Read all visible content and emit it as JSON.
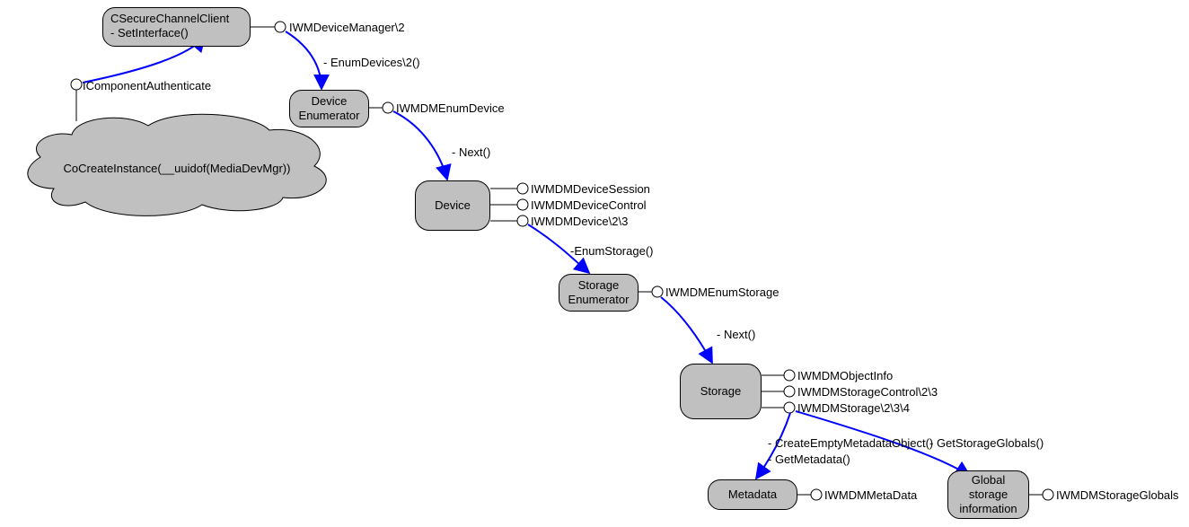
{
  "nodes": {
    "secure_channel": {
      "line1": "CSecureChannelClient",
      "line2": "- SetInterface()"
    },
    "cocreate": "CoCreateInstance(__uuidof(MediaDevMgr))",
    "device_enum": {
      "line1": "Device",
      "line2": "Enumerator"
    },
    "device": "Device",
    "storage_enum": {
      "line1": "Storage",
      "line2": "Enumerator"
    },
    "storage": "Storage",
    "metadata": "Metadata",
    "global_storage": {
      "line1": "Global",
      "line2": "storage",
      "line3": "information"
    }
  },
  "interfaces": {
    "icomponent_auth": "IComponentAuthenticate",
    "iwmdevicemanager": "IWMDeviceManager\\2",
    "iwmdm_enumdevice": "IWMDMEnumDevice",
    "iwmdm_devicesession": "IWMDMDeviceSession",
    "iwmdm_devicecontrol": "IWMDMDeviceControl",
    "iwmdm_device": "IWMDMDevice\\2\\3",
    "iwmdm_enumstorage": "IWMDMEnumStorage",
    "iwmdm_objectinfo": "IWMDMObjectInfo",
    "iwmdm_storagecontrol": "IWMDMStorageControl\\2\\3",
    "iwmdm_storage": "IWMDMStorage\\2\\3\\4",
    "iwmdm_metadata": "IWMDMMetaData",
    "iwmdm_storageglobals": "IWMDMStorageGlobals"
  },
  "methods": {
    "enum_devices": "- EnumDevices\\2()",
    "next1": "- Next()",
    "enum_storage": "-EnumStorage()",
    "next2": "- Next()",
    "create_empty_meta": "- CreateEmptyMetadataObject()",
    "get_metadata": "- GetMetadata()",
    "get_storage_globals": "- GetStorageGlobals()"
  }
}
